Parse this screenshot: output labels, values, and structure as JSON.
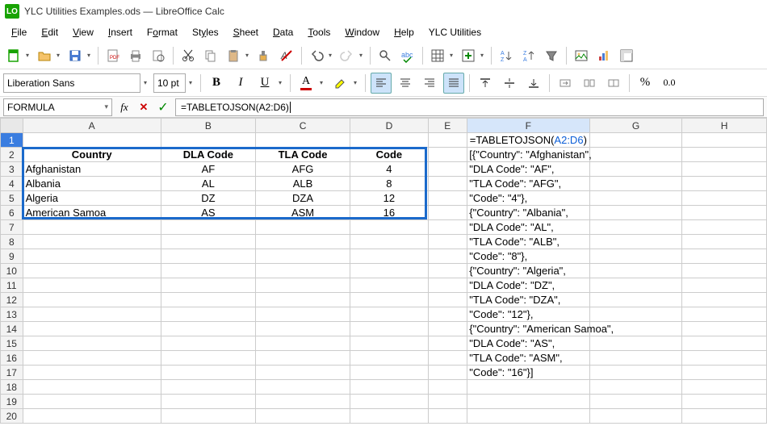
{
  "app": {
    "title": "YLC Utilities Examples.ods — LibreOffice Calc",
    "icon_label": "LO"
  },
  "menu": {
    "file": "File",
    "edit": "Edit",
    "view": "View",
    "insert": "Insert",
    "format": "Format",
    "styles": "Styles",
    "sheet": "Sheet",
    "data": "Data",
    "tools": "Tools",
    "window": "Window",
    "help": "Help",
    "ylc": "YLC Utilities"
  },
  "format_bar": {
    "font_name": "Liberation Sans",
    "font_size": "10 pt",
    "percent_glyph": "%",
    "decimal_glyph": "0.0"
  },
  "formula_bar": {
    "name_box": "FORMULA",
    "fx_label": "fx",
    "cancel": "✕",
    "accept": "✓",
    "formula": "=TABLETOJSON(A2:D6)"
  },
  "columns": [
    "A",
    "B",
    "C",
    "D",
    "E",
    "F",
    "G",
    "H"
  ],
  "row_count": 20,
  "table": {
    "headers": [
      "Country",
      "DLA Code",
      "TLA Code",
      "Code"
    ],
    "rows": [
      {
        "country": "Afghanistan",
        "dla": "AF",
        "tla": "AFG",
        "code": "4"
      },
      {
        "country": "Albania",
        "dla": "AL",
        "tla": "ALB",
        "code": "8"
      },
      {
        "country": "Algeria",
        "dla": "DZ",
        "tla": "DZA",
        "code": "12"
      },
      {
        "country": "American Samoa",
        "dla": "AS",
        "tla": "ASM",
        "code": "16"
      }
    ]
  },
  "f1_prefix": "=TABLETOJSON(",
  "f1_ref": "A2:D6",
  "f1_suffix": ")",
  "json_lines": [
    "[{\"Country\": \"Afghanistan\",",
    "\"DLA Code\": \"AF\",",
    "\"TLA Code\": \"AFG\",",
    "\"Code\": \"4\"},",
    "{\"Country\": \"Albania\",",
    "\"DLA Code\": \"AL\",",
    "\"TLA Code\": \"ALB\",",
    "\"Code\": \"8\"},",
    "{\"Country\": \"Algeria\",",
    "\"DLA Code\": \"DZ\",",
    "\"TLA Code\": \"DZA\",",
    "\"Code\": \"12\"},",
    "{\"Country\": \"American Samoa\",",
    "\"DLA Code\": \"AS\",",
    "\"TLA Code\": \"ASM\",",
    "\"Code\": \"16\"}]"
  ],
  "chart_data": {
    "type": "table",
    "title": "Country codes",
    "columns": [
      "Country",
      "DLA Code",
      "TLA Code",
      "Code"
    ],
    "rows": [
      [
        "Afghanistan",
        "AF",
        "AFG",
        4
      ],
      [
        "Albania",
        "AL",
        "ALB",
        8
      ],
      [
        "Algeria",
        "DZ",
        "DZA",
        12
      ],
      [
        "American Samoa",
        "AS",
        "ASM",
        16
      ]
    ]
  }
}
